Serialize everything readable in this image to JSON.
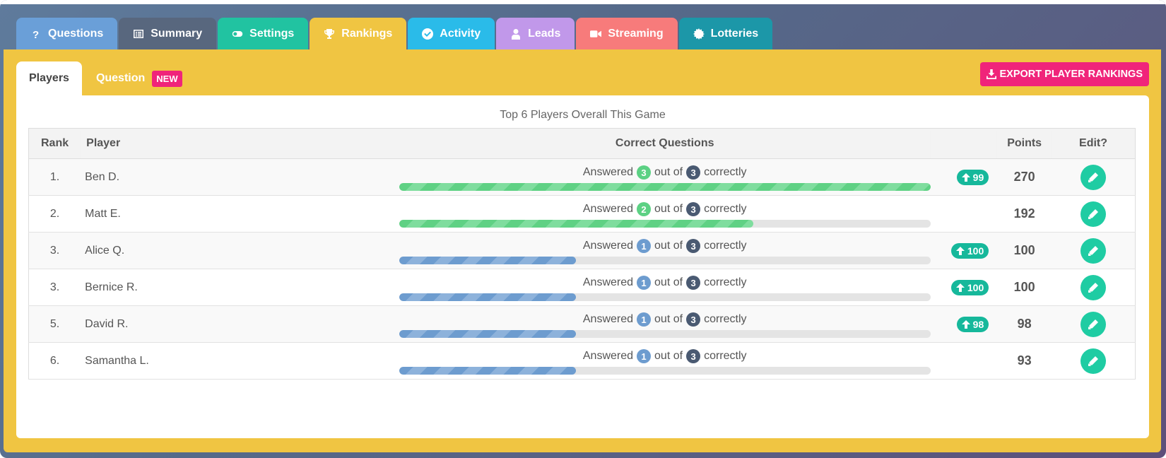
{
  "tabs": [
    {
      "label": "Questions",
      "icon": "question-icon"
    },
    {
      "label": "Summary",
      "icon": "list-icon"
    },
    {
      "label": "Settings",
      "icon": "toggle-icon"
    },
    {
      "label": "Rankings",
      "icon": "trophy-icon"
    },
    {
      "label": "Activity",
      "icon": "check-circle-icon"
    },
    {
      "label": "Leads",
      "icon": "user-icon"
    },
    {
      "label": "Streaming",
      "icon": "video-camera-icon"
    },
    {
      "label": "Lotteries",
      "icon": "cog-icon"
    }
  ],
  "subtabs": {
    "players": "Players",
    "question": "Question",
    "new_badge": "NEW"
  },
  "export_label": "EXPORT PLAYER RANKINGS",
  "table_title": "Top 6 Players Overall This Game",
  "columns": {
    "rank": "Rank",
    "player": "Player",
    "correct": "Correct Questions",
    "points": "Points",
    "edit": "Edit?"
  },
  "answer_text": {
    "prefix": "Answered",
    "middle": "out of",
    "suffix": "correctly"
  },
  "rows": [
    {
      "rank": "1.",
      "player": "Ben D.",
      "correct": "3",
      "total": "3",
      "fraction": 1.0,
      "color": "green",
      "delta": "99",
      "points": "270"
    },
    {
      "rank": "2.",
      "player": "Matt E.",
      "correct": "2",
      "total": "3",
      "fraction": 0.667,
      "color": "green",
      "delta": "",
      "points": "192"
    },
    {
      "rank": "3.",
      "player": "Alice Q.",
      "correct": "1",
      "total": "3",
      "fraction": 0.333,
      "color": "blue",
      "delta": "100",
      "points": "100"
    },
    {
      "rank": "3.",
      "player": "Bernice R.",
      "correct": "1",
      "total": "3",
      "fraction": 0.333,
      "color": "blue",
      "delta": "100",
      "points": "100"
    },
    {
      "rank": "5.",
      "player": "David R.",
      "correct": "1",
      "total": "3",
      "fraction": 0.333,
      "color": "blue",
      "delta": "98",
      "points": "98"
    },
    {
      "rank": "6.",
      "player": "Samantha L.",
      "correct": "1",
      "total": "3",
      "fraction": 0.333,
      "color": "blue",
      "delta": "",
      "points": "93"
    }
  ],
  "colors": {
    "panel": "#f0c542",
    "accent_pink": "#f0247a",
    "teal": "#1fcca3"
  }
}
